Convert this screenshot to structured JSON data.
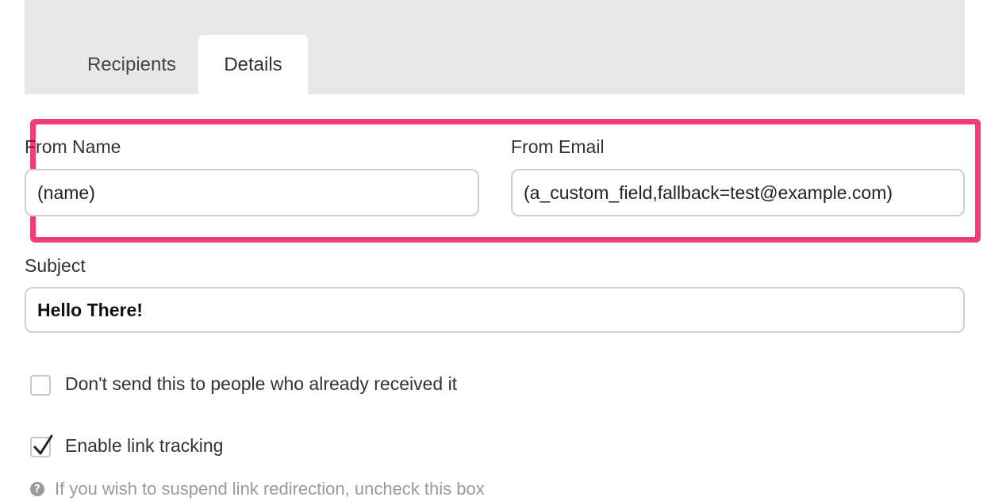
{
  "tabs": [
    {
      "label": "Recipients",
      "active": false
    },
    {
      "label": "Details",
      "active": true
    }
  ],
  "from_name": {
    "label": "From Name",
    "value": "(name)"
  },
  "from_email": {
    "label": "From Email",
    "value": "(a_custom_field,fallback=test@example.com)"
  },
  "subject": {
    "label": "Subject",
    "value": "Hello There!"
  },
  "options": {
    "dont_resend": {
      "label": "Don't send this to people who already received it",
      "checked": false
    },
    "link_tracking": {
      "label": "Enable link tracking",
      "checked": true
    }
  },
  "hint": {
    "icon": "info-icon",
    "text": "If you wish to suspend link redirection, uncheck this box"
  },
  "colors": {
    "highlight": "#f13c75",
    "tabbar": "#e8e8e8"
  }
}
